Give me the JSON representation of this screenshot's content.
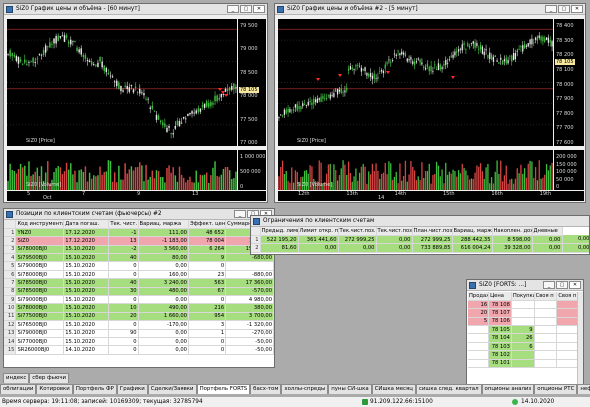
{
  "chart1": {
    "title": "SiZ0 График цены и объёма - [60 минут]",
    "price_ticks": [
      "79 500",
      "79 000",
      "78 500",
      "78 000",
      "77 500",
      "77 000"
    ],
    "last_price_label": "78 105",
    "price_legend": "SiZ0 [Price]",
    "volume_ticks": [
      "1 000 000",
      "500 000",
      "0"
    ],
    "volume_legend": "SiZ0 [Volume]",
    "date_ticks": [
      "5",
      "7",
      "9",
      "13"
    ],
    "date_month": "Oct"
  },
  "chart2": {
    "title": "SiZ0 График цены и объёма #2 - [5 минут]",
    "price_ticks": [
      "78 400",
      "78 300",
      "78 200",
      "78 100",
      "78 000",
      "77 900",
      "77 800",
      "77 700",
      "77 600"
    ],
    "last_price_label": "78 105",
    "price_legend": "SiZ0 [Price]",
    "volume_ticks": [
      "200 000",
      "150 000",
      "100 000",
      "50 000",
      "0"
    ],
    "volume_legend": "SiZ0 [Volume]",
    "date_ticks": [
      "12th",
      "13th",
      "14th",
      "15th",
      "16th",
      "19th"
    ],
    "date_sub": "14"
  },
  "positions": {
    "title": "Позиции по клиентским счетам (фьючерсы) #2",
    "columns": [
      "",
      "Код инструмента",
      "Дата погаш.",
      "Тек. чист. поз.",
      "Вариац. маржа",
      "Эффект. цена",
      "Суммарная в."
    ],
    "rows": [
      {
        "n": "1",
        "code": "YNZ0",
        "date": "17.12.2020",
        "pos": "-1",
        "margin": "111,00",
        "price": "48 652",
        "sum": "-72,00",
        "style": "green"
      },
      {
        "n": "2",
        "code": "SiZ0",
        "date": "17.12.2020",
        "pos": "13",
        "margin": "-1 183,00",
        "price": "78 004",
        "sum": "1 280,00",
        "style": "red"
      },
      {
        "n": "3",
        "code": "Si78000BJ0",
        "date": "15.10.2020",
        "pos": "-2",
        "margin": "3 560,00",
        "price": "6 264",
        "sum": "15 520,00",
        "style": "green"
      },
      {
        "n": "4",
        "code": "Si79500BJ0",
        "date": "15.10.2020",
        "pos": "40",
        "margin": "80,00",
        "price": "9",
        "sum": "-680,00",
        "style": "green"
      },
      {
        "n": "5",
        "code": "Si79000BJ0",
        "date": "15.10.2020",
        "pos": "0",
        "margin": "0,00",
        "price": "0",
        "sum": "",
        "style": "white"
      },
      {
        "n": "6",
        "code": "Si78000BJ0",
        "date": "15.10.2020",
        "pos": "0",
        "margin": "160,00",
        "price": "23",
        "sum": "-880,00",
        "style": "white"
      },
      {
        "n": "7",
        "code": "Si78500BJ0",
        "date": "15.10.2020",
        "pos": "40",
        "margin": "3 240,00",
        "price": "563",
        "sum": "17 360,00",
        "style": "green"
      },
      {
        "n": "8",
        "code": "Si78500BJ0",
        "date": "15.10.2020",
        "pos": "30",
        "margin": "480,00",
        "price": "67",
        "sum": "-570,00",
        "style": "green"
      },
      {
        "n": "9",
        "code": "Si79000BJ0",
        "date": "15.10.2020",
        "pos": "0",
        "margin": "0,00",
        "price": "0",
        "sum": "4 980,00",
        "style": "white"
      },
      {
        "n": "10",
        "code": "Si78000BJ0",
        "date": "15.10.2020",
        "pos": "10",
        "margin": "490,00",
        "price": "216",
        "sum": "380,00",
        "style": "green"
      },
      {
        "n": "11",
        "code": "Si77500BJ0",
        "date": "15.10.2020",
        "pos": "20",
        "margin": "1 660,00",
        "price": "954",
        "sum": "3 700,00",
        "style": "green"
      },
      {
        "n": "12",
        "code": "Si76500BJ0",
        "date": "15.10.2020",
        "pos": "0",
        "margin": "-170,00",
        "price": "3",
        "sum": "-1 320,00",
        "style": "white"
      },
      {
        "n": "13",
        "code": "Si79000BJ0",
        "date": "15.10.2020",
        "pos": "90",
        "margin": "0,00",
        "price": "1",
        "sum": "-270,00",
        "style": "white"
      },
      {
        "n": "14",
        "code": "Si77000BJ0",
        "date": "15.10.2020",
        "pos": "0",
        "margin": "0,00",
        "price": "0",
        "sum": "-50,00",
        "style": "white"
      },
      {
        "n": "15",
        "code": "SR26000BJ0",
        "date": "14.10.2020",
        "pos": "0",
        "margin": "0,00",
        "price": "0",
        "sum": "-50,00",
        "style": "white"
      }
    ]
  },
  "limits": {
    "title": "Ограничения по клиентским счетам",
    "columns": [
      "",
      "Предыд. лимит",
      "Лимит откр. п.",
      "Тек.чист.поз.",
      "Тек.чист.поз. (Под заявки)",
      "План.чист.поз.",
      "Вариац. маржа",
      "Накоплен. доход",
      "Дневные"
    ],
    "rows": [
      {
        "n": "1",
        "c1": "522 195,20",
        "c2": "361 441,60",
        "c3": "272 999,25",
        "c4": "0,00",
        "c5": "272 999,25",
        "c6": "288 442,35",
        "c7": "8 598,00",
        "c8": "0,00",
        "c9": "0,00",
        "style": "green"
      },
      {
        "n": "2",
        "c1": "81,60",
        "c2": "0,00",
        "c3": "0,00",
        "c4": "0,00",
        "c5": "733 889,85",
        "c6": "616 004,24",
        "c7": "39 328,00",
        "c8": "0,00",
        "c9": "0,00",
        "style": "green"
      }
    ]
  },
  "orderbook": {
    "title": "SiZ0 [FORTS: ...]",
    "columns": [
      "Продаж",
      "Цена",
      "Покупка",
      "Своя п",
      "Своя п"
    ],
    "rows": [
      {
        "sell": "16",
        "price": "78 108",
        "buy": "",
        "style": "red"
      },
      {
        "sell": "20",
        "price": "78 107",
        "buy": "",
        "style": "red"
      },
      {
        "sell": "5",
        "price": "78 106",
        "buy": "",
        "style": "red"
      },
      {
        "sell": "",
        "price": "78 105",
        "buy": "9",
        "style": "green"
      },
      {
        "sell": "",
        "price": "78 104",
        "buy": "26",
        "style": "green"
      },
      {
        "sell": "",
        "price": "78 103",
        "buy": "6",
        "style": "green"
      },
      {
        "sell": "",
        "price": "78 102",
        "buy": "",
        "style": "green"
      },
      {
        "sell": "",
        "price": "78 101",
        "buy": "",
        "style": "green"
      }
    ]
  },
  "workspace_tabs_top": [
    "индекс",
    "сбер фьючи"
  ],
  "workspace_tabs": [
    "облигации",
    "Котировки",
    "Портфель ФР",
    "Графики",
    "Сделки/Заявки",
    "Портфель FORTS",
    "басх-том",
    "холлы-спреды",
    "пуны СИ-шка",
    "СИшка месяц",
    "сишка след. квартал",
    "опционы анализ",
    "опционы РТС",
    "нефть..."
  ],
  "active_tab": "Портфель FORTS",
  "status": {
    "server_time": "Время сервера: 19:11:08; записей: 10169309; текущая: 32785794",
    "connection": "91.209.122.66:15100",
    "date": "14.10.2020"
  }
}
